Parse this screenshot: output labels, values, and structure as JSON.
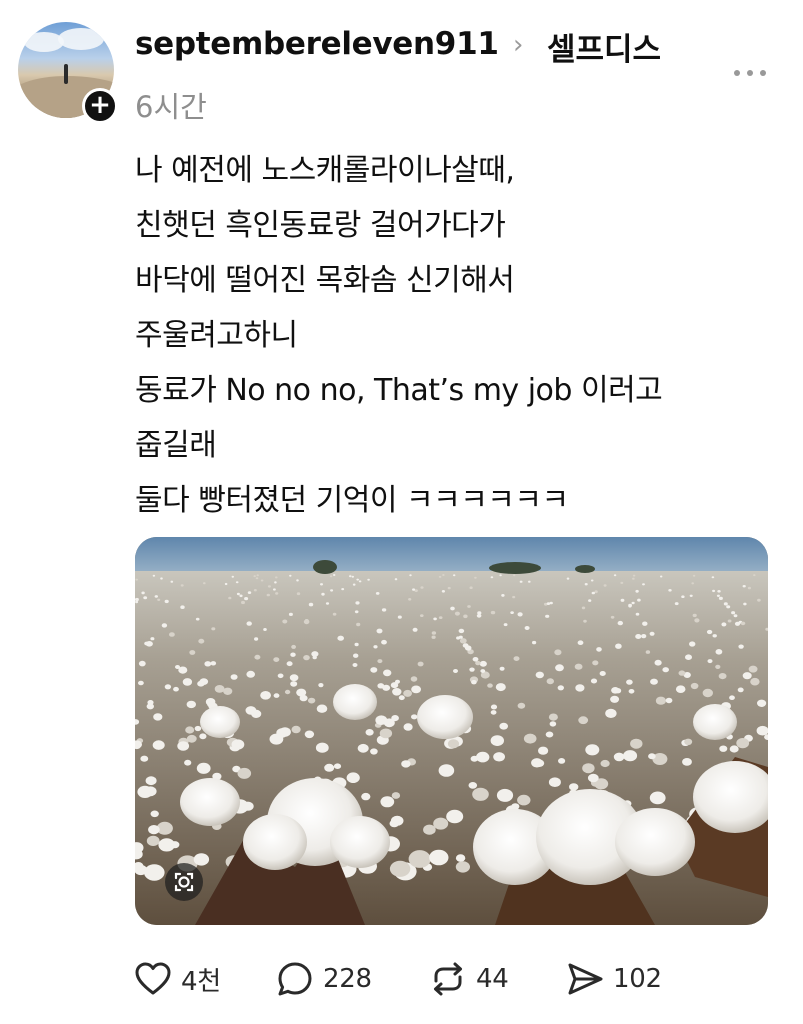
{
  "post": {
    "author": {
      "username": "septembereleven911",
      "breadcrumb_separator": "›",
      "community": "셀프디스",
      "timestamp": "6시간",
      "follow_label": "+"
    },
    "body_lines": [
      "나 예전에 노스캐롤라이나살때,",
      "친햇던 흑인동료랑 걸어가다가",
      "바닥에 떨어진 목화솜 신기해서",
      "주울려고하니",
      "동료가 No no no, That’s my job 이러고",
      "줍길래",
      "둘다 빵터졌던 기억이 ㅋㅋㅋㅋㅋㅋ"
    ],
    "image": {
      "subject": "cotton-field",
      "sky_color": "#6f8fae",
      "cotton_color": "#f4f2ee"
    },
    "actions": {
      "like": {
        "icon": "heart-icon",
        "count": "4천"
      },
      "comment": {
        "icon": "comment-bubble-icon",
        "count": "228"
      },
      "repost": {
        "icon": "repost-icon",
        "count": "44"
      },
      "share": {
        "icon": "send-icon",
        "count": "102"
      }
    }
  },
  "colors": {
    "text": "#101010",
    "muted": "#8e8e8e",
    "icon": "#2a2a2a"
  }
}
